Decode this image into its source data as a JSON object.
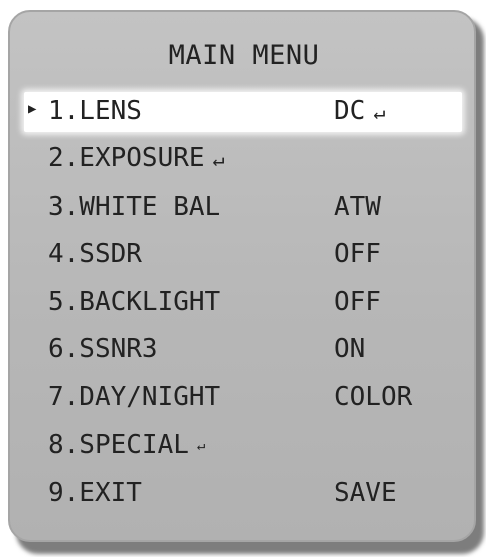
{
  "menu": {
    "title": "MAIN MENU",
    "cursor": "▶",
    "items": [
      {
        "label": "1.LENS",
        "value": "DC",
        "enter": "↵"
      },
      {
        "label": "2.EXPOSURE",
        "value": "",
        "enter": "↵"
      },
      {
        "label": "3.WHITE BAL",
        "value": "ATW",
        "enter": ""
      },
      {
        "label": "4.SSDR",
        "value": "OFF",
        "enter": ""
      },
      {
        "label": "5.BACKLIGHT",
        "value": "OFF",
        "enter": ""
      },
      {
        "label": "6.SSNR3",
        "value": "ON",
        "enter": ""
      },
      {
        "label": "7.DAY/NIGHT",
        "value": "COLOR",
        "enter": ""
      },
      {
        "label": "8.SPECIAL",
        "value": "",
        "enter": "↵"
      },
      {
        "label": "9.EXIT",
        "value": "SAVE",
        "enter": ""
      }
    ]
  }
}
